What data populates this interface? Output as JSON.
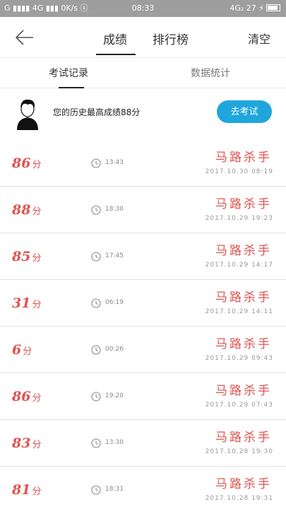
{
  "status_bar": {
    "left": "G ▮▮▮▮ 4G ▮▮▮ 0K/s ⓢ",
    "time": "08:33",
    "right": "4G₂ 27 ⚡"
  },
  "header": {
    "tabs": [
      {
        "label": "成绩"
      },
      {
        "label": "排行榜"
      }
    ],
    "clear_label": "清空"
  },
  "subtabs": [
    {
      "label": "考试记录"
    },
    {
      "label": "数据统计"
    }
  ],
  "summary": {
    "best_text": "您的历史最高成绩88分",
    "exam_button": "去考试"
  },
  "records": [
    {
      "score": "86",
      "unit": "分",
      "duration": "13:43",
      "name": "马路杀手",
      "date": "2017.10.30  08:19"
    },
    {
      "score": "88",
      "unit": "分",
      "duration": "18:30",
      "name": "马路杀手",
      "date": "2017.10.29  19:23"
    },
    {
      "score": "85",
      "unit": "分",
      "duration": "17:45",
      "name": "马路杀手",
      "date": "2017.10.29  14:17"
    },
    {
      "score": "31",
      "unit": "分",
      "duration": "06:19",
      "name": "马路杀手",
      "date": "2017.10.29  14:11"
    },
    {
      "score": "6",
      "unit": "分",
      "duration": "00:26",
      "name": "马路杀手",
      "date": "2017.10.29  09:43"
    },
    {
      "score": "86",
      "unit": "分",
      "duration": "19:20",
      "name": "马路杀手",
      "date": "2017.10.29  07:43"
    },
    {
      "score": "83",
      "unit": "分",
      "duration": "13:30",
      "name": "马路杀手",
      "date": "2017.10.28  19:30"
    },
    {
      "score": "81",
      "unit": "分",
      "duration": "18:31",
      "name": "马路杀手",
      "date": "2017.10.28  19:31"
    }
  ],
  "colors": {
    "accent": "#1fa6dc",
    "score": "#e0524f"
  }
}
